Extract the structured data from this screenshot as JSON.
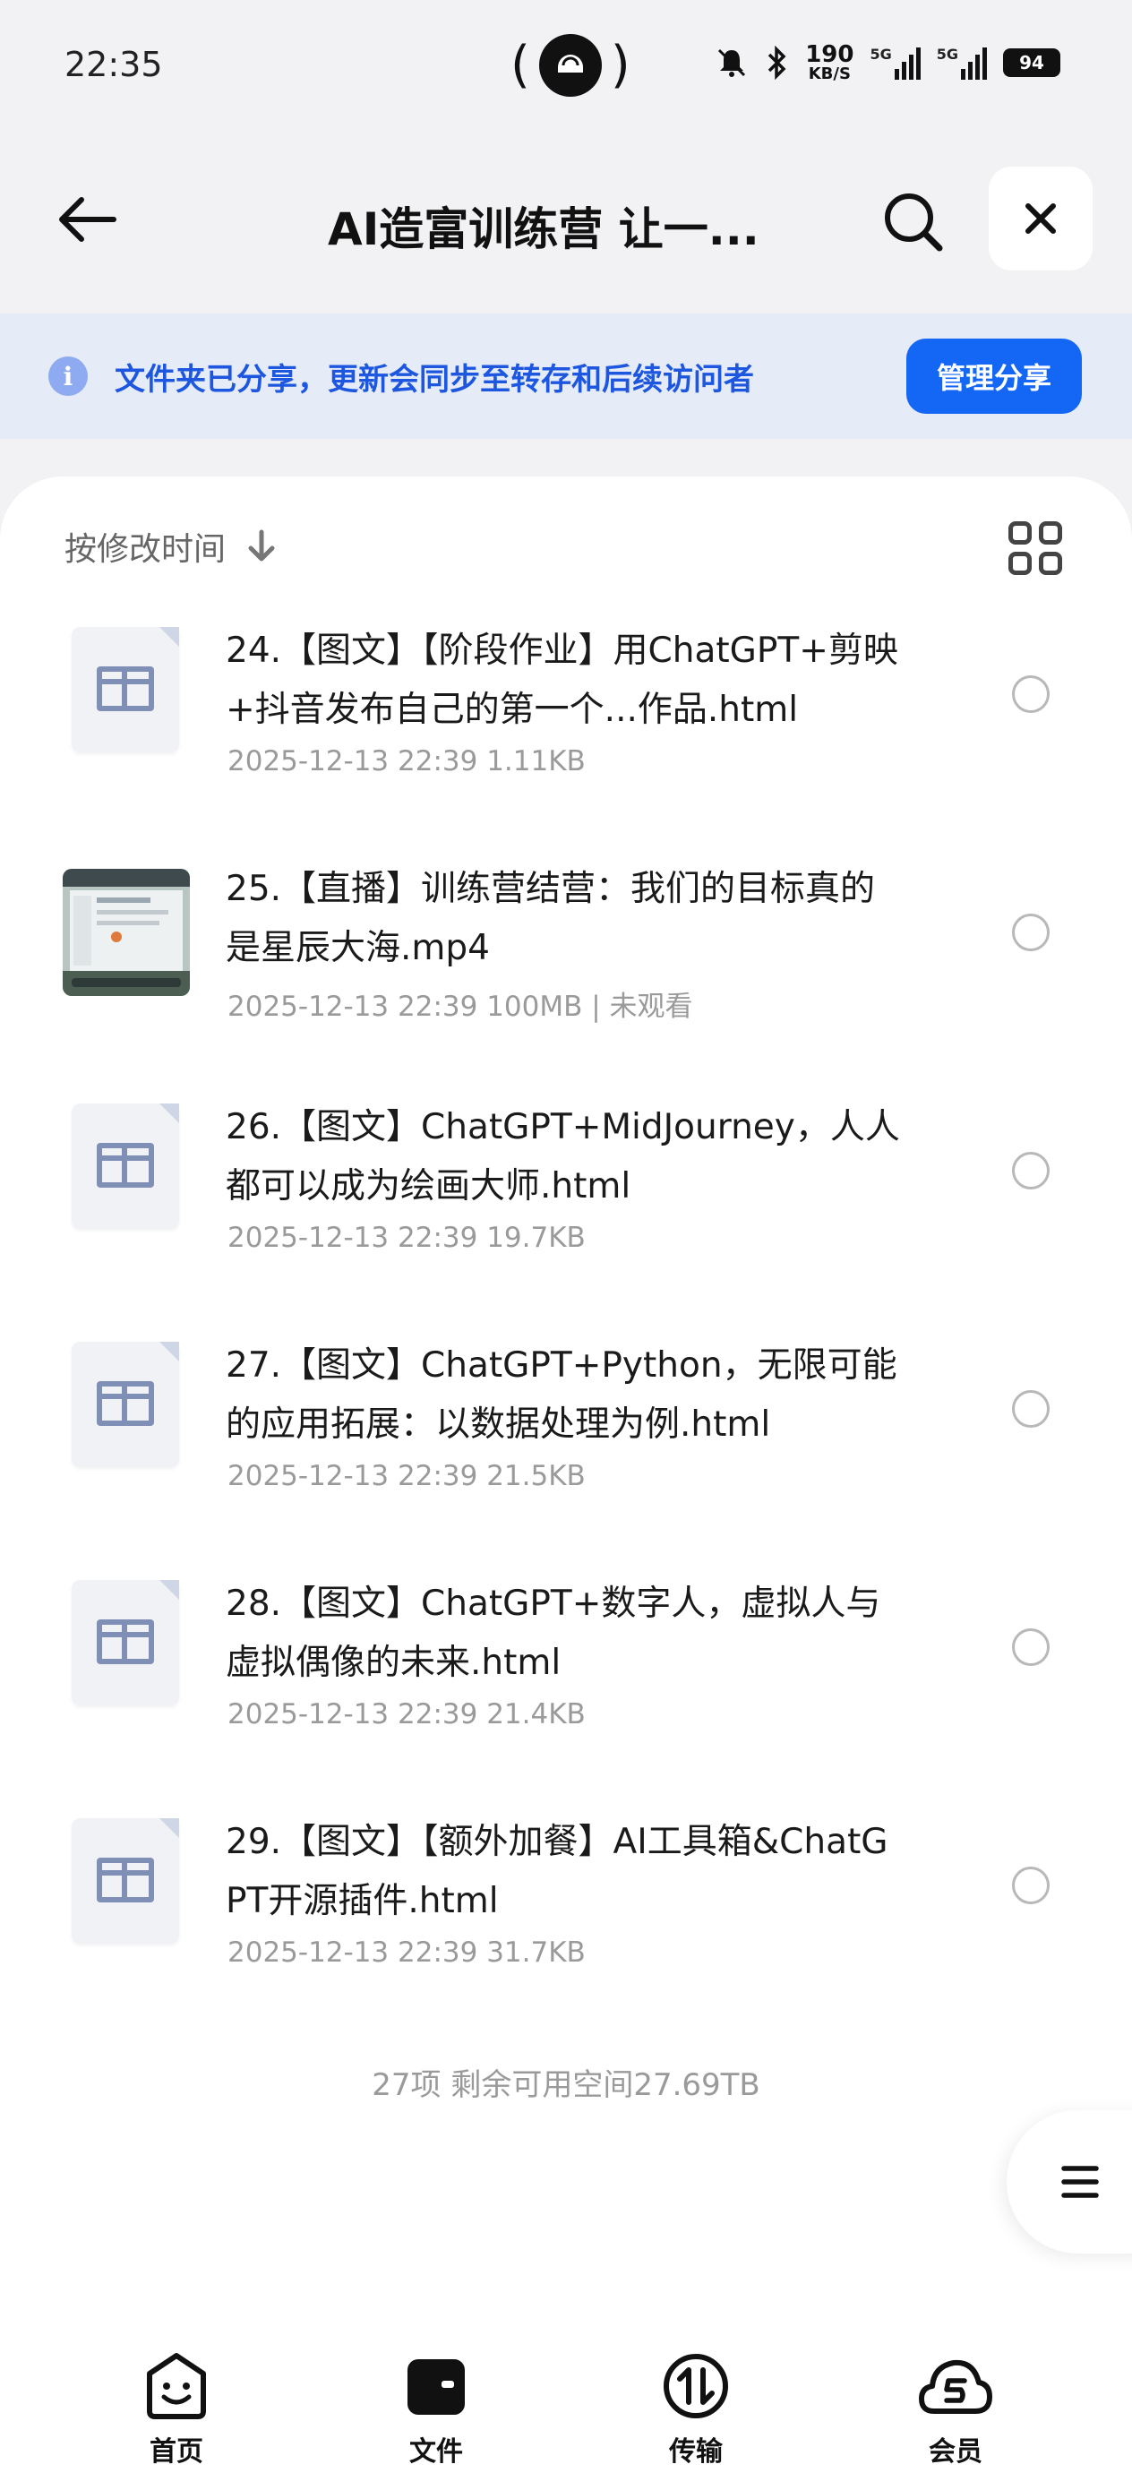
{
  "status_bar": {
    "time": "22:35",
    "speed_value": "190",
    "speed_unit": "KB/S",
    "signal_1": "5G",
    "signal_2": "5G",
    "battery": "94"
  },
  "header": {
    "title": "AI造富训练营 让一...",
    "back_icon": "arrow-left-icon",
    "search_icon": "search-icon",
    "close_icon": "close-icon"
  },
  "share_banner": {
    "text": "文件夹已分享，更新会同步至转存和后续访问者",
    "button_label": "管理分享",
    "accent_color": "#1466f5"
  },
  "sort": {
    "label": "按修改时间"
  },
  "files": [
    {
      "name": "24.【图文】【阶段作业】用ChatGPT+剪映+抖音发布自己的第一个...作品.html",
      "meta": "2025-12-13 22:39  1.11KB",
      "type": "html"
    },
    {
      "name": "25.【直播】训练营结营：我们的目标真的是星辰大海.mp4",
      "meta": "2025-12-13 22:39  100MB | 未观看",
      "type": "video"
    },
    {
      "name": "26.【图文】ChatGPT+MidJourney，人人都可以成为绘画大师.html",
      "meta": "2025-12-13 22:39  19.7KB",
      "type": "html"
    },
    {
      "name": "27.【图文】ChatGPT+Python，无限可能的应用拓展：以数据处理为例.html",
      "meta": "2025-12-13 22:39  21.5KB",
      "type": "html"
    },
    {
      "name": "28.【图文】ChatGPT+数字人，虚拟人与虚拟偶像的未来.html",
      "meta": "2025-12-13 22:39  21.4KB",
      "type": "html"
    },
    {
      "name": "29.【图文】【额外加餐】AI工具箱&ChatGPT开源插件.html",
      "meta": "2025-12-13 22:39  31.7KB",
      "type": "html"
    }
  ],
  "summary": "27项 剩余可用空间27.69TB",
  "bottom_nav": [
    {
      "label": "首页",
      "icon": "smile-face-icon"
    },
    {
      "label": "文件",
      "icon": "folder-icon"
    },
    {
      "label": "传输",
      "icon": "transfer-icon"
    },
    {
      "label": "会员",
      "icon": "member-cloud-icon"
    }
  ]
}
